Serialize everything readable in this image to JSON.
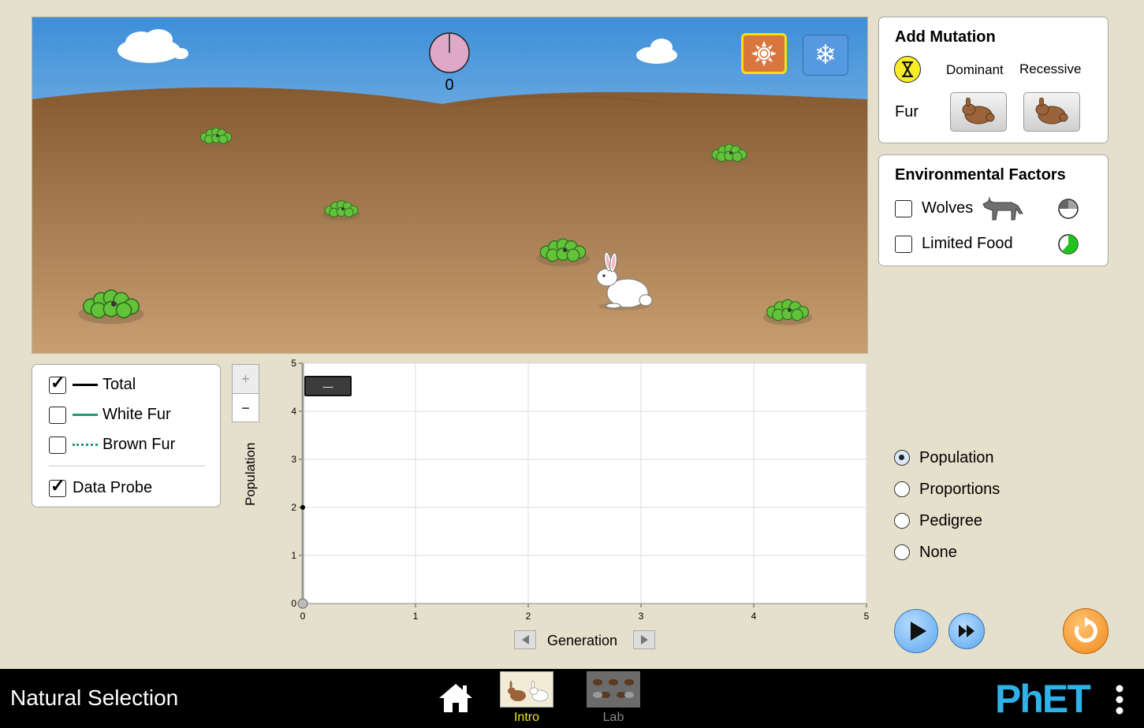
{
  "scene": {
    "generation_counter": "0",
    "sun_icon": "sun-icon",
    "snow_icon": "snowflake-icon",
    "colors": {
      "sky_top": "#3d8ed8",
      "sky_bottom": "#d4ecf7",
      "ground": "#9e6f45",
      "sun_button": "#d9763e",
      "snow_button": "#5599e0"
    }
  },
  "mutation": {
    "title": "Add Mutation",
    "dominant_label": "Dominant",
    "recessive_label": "Recessive",
    "fur_label": "Fur"
  },
  "environment": {
    "title": "Environmental Factors",
    "wolves_label": "Wolves",
    "food_label": "Limited Food",
    "wolves_checked": false,
    "food_checked": false
  },
  "legend": {
    "total_label": "Total",
    "white_fur_label": "White Fur",
    "brown_fur_label": "Brown Fur",
    "data_probe_label": "Data Probe",
    "total_checked": true,
    "white_checked": false,
    "brown_checked": false,
    "probe_checked": true,
    "colors": {
      "total": "#000000",
      "white_fur": "#1f9a73",
      "brown_fur": "#1f9a73"
    }
  },
  "zoom": {
    "plus": "+",
    "minus": "−"
  },
  "chart_data": {
    "type": "line",
    "xlabel": "Generation",
    "ylabel": "Population",
    "xlim": [
      0,
      5
    ],
    "ylim": [
      0,
      5
    ],
    "x_ticks": [
      "0",
      "1",
      "2",
      "3",
      "4",
      "5"
    ],
    "y_ticks": [
      "0",
      "1",
      "2",
      "3",
      "4",
      "5"
    ],
    "series": [
      {
        "name": "Total",
        "points": [
          [
            0,
            2
          ]
        ]
      }
    ],
    "probe_value": "—"
  },
  "graph_options": {
    "items": [
      {
        "label": "Population",
        "selected": true
      },
      {
        "label": "Proportions",
        "selected": false
      },
      {
        "label": "Pedigree",
        "selected": false
      },
      {
        "label": "None",
        "selected": false
      }
    ]
  },
  "navbar": {
    "title": "Natural Selection",
    "screens": [
      {
        "label": "Intro",
        "active": true
      },
      {
        "label": "Lab",
        "active": false
      }
    ],
    "brand": "PhET",
    "colors": {
      "active_label": "#f2e916",
      "inactive_label": "#888888",
      "brand": "#2fb2e8"
    }
  }
}
